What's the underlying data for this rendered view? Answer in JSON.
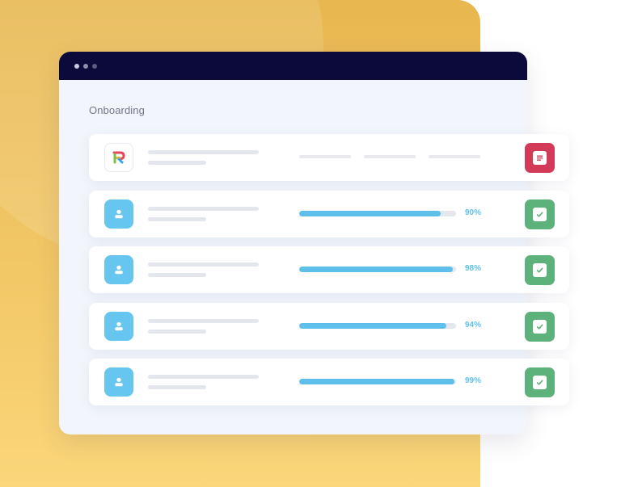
{
  "page": {
    "heading": "Onboarding"
  },
  "colors": {
    "titlebar": "#0b0a3a",
    "backdrop": "#f2c766",
    "progress": "#5ec0ea",
    "avatar": "#67c6ef",
    "status_doc": "#d33a57",
    "status_ok": "#5cb27a"
  },
  "rows": [
    {
      "type": "company",
      "icon": "brand-logo-icon",
      "status_icon": "document-icon"
    },
    {
      "type": "user",
      "icon": "user-icon",
      "progress": 0.9,
      "percent_label": "90%",
      "status_icon": "check-icon"
    },
    {
      "type": "user",
      "icon": "user-icon",
      "progress": 0.98,
      "percent_label": "98%",
      "status_icon": "check-icon"
    },
    {
      "type": "user",
      "icon": "user-icon",
      "progress": 0.94,
      "percent_label": "94%",
      "status_icon": "check-icon"
    },
    {
      "type": "user",
      "icon": "user-icon",
      "progress": 0.99,
      "percent_label": "99%",
      "status_icon": "check-icon"
    }
  ]
}
